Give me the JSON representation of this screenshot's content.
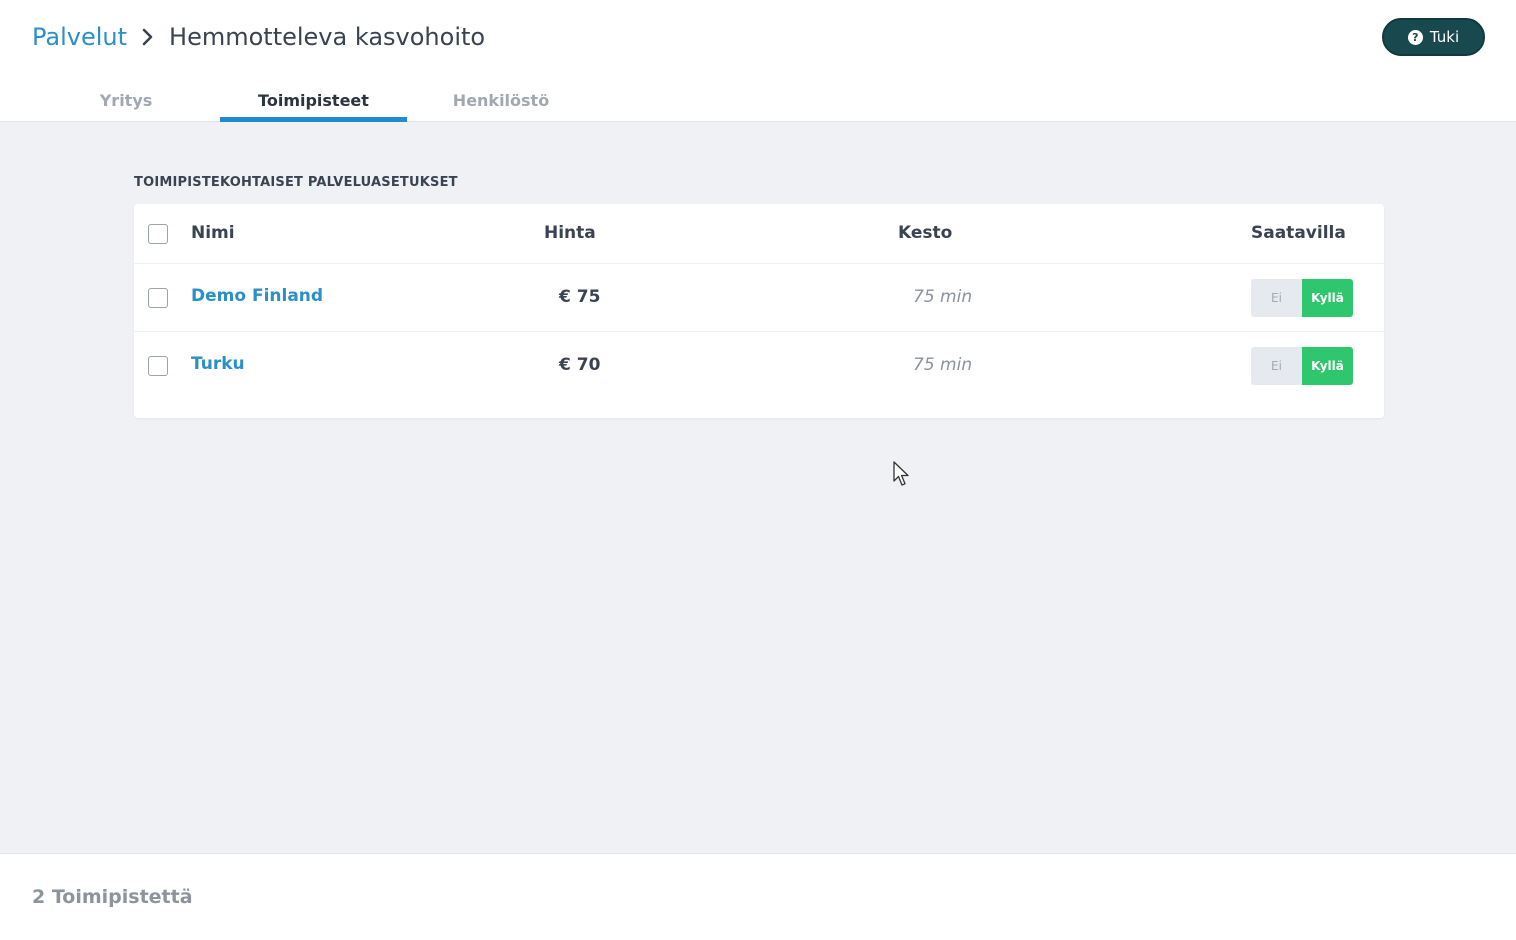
{
  "header": {
    "breadcrumb_parent": "Palvelut",
    "breadcrumb_current": "Hemmotteleva kasvohoito",
    "help_label": "Tuki"
  },
  "tabs": [
    {
      "label": "Yritys",
      "active": false
    },
    {
      "label": "Toimipisteet",
      "active": true
    },
    {
      "label": "Henkilöstö",
      "active": false
    }
  ],
  "section_title": "TOIMIPISTEKOHTAISET PALVELUASETUKSET",
  "table": {
    "columns": [
      "Nimi",
      "Hinta",
      "Kesto",
      "Saatavilla"
    ],
    "rows": [
      {
        "name": "Demo Finland",
        "price": "€ 75",
        "duration": "75 min",
        "available_off": "Ei",
        "available_on": "Kyllä",
        "available": true
      },
      {
        "name": "Turku",
        "price": "€ 70",
        "duration": "75 min",
        "available_off": "Ei",
        "available_on": "Kyllä",
        "available": true
      }
    ]
  },
  "footer": {
    "count_text": "2 Toimipistettä"
  },
  "colors": {
    "accent": "#2b8fc8",
    "tab_underline": "#1e8ccf",
    "help_button": "#18494f",
    "toggle_on": "#2ec76d",
    "background": "#eff1f5"
  },
  "icons": [
    "chevron-right-icon",
    "help-circle-icon",
    "mouse-cursor-icon"
  ]
}
